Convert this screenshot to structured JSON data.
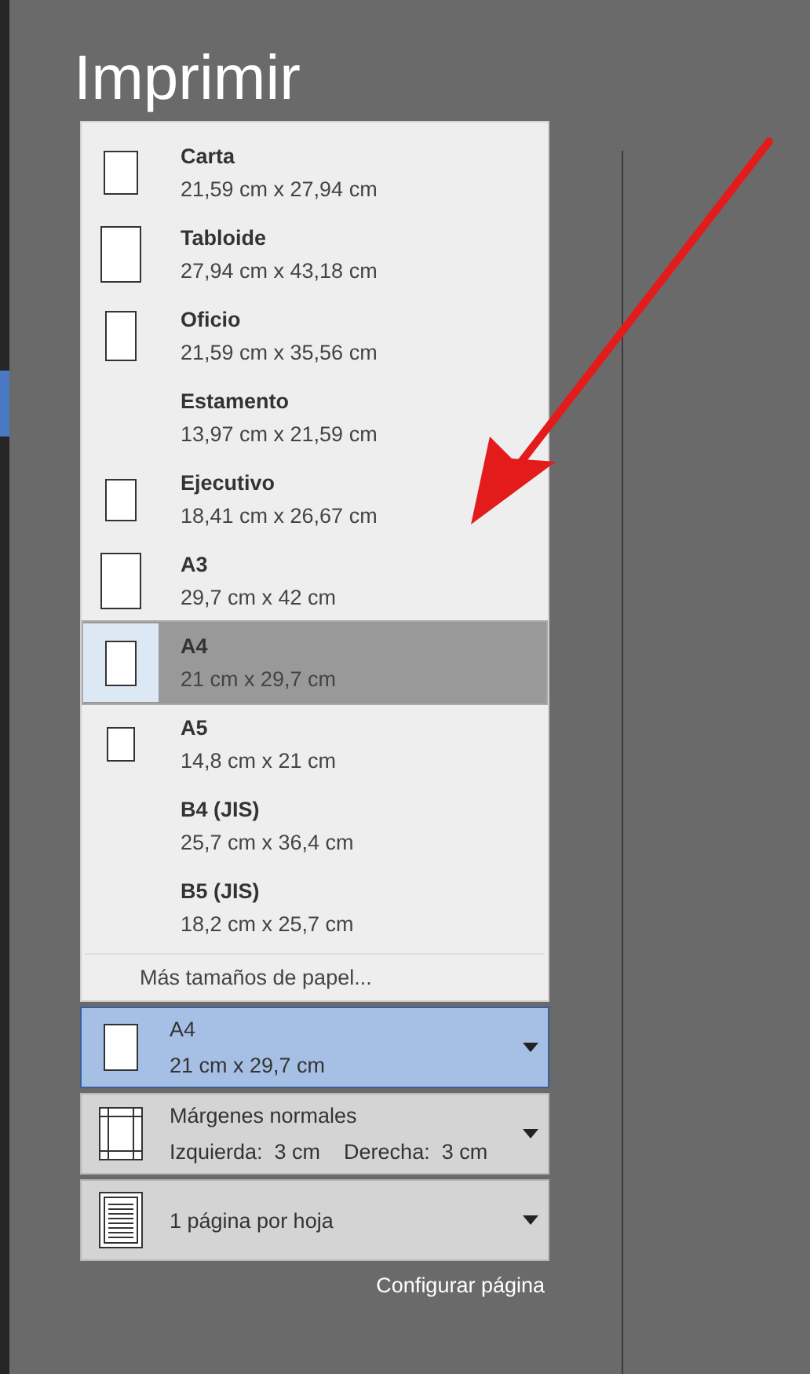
{
  "title": "Imprimir",
  "paper_sizes": [
    {
      "name": "Carta",
      "size": "21,59 cm x 27,94 cm",
      "kind": "letter",
      "selected": false
    },
    {
      "name": "Tabloide",
      "size": "27,94 cm x 43,18 cm",
      "kind": "tabloid",
      "selected": false
    },
    {
      "name": "Oficio",
      "size": "21,59 cm x 35,56 cm",
      "kind": "legal",
      "selected": false
    },
    {
      "name": "Estamento",
      "size": "13,97 cm x 21,59 cm",
      "selected": false
    },
    {
      "name": "Ejecutivo",
      "size": "18,41 cm x 26,67 cm",
      "kind": "executive",
      "selected": false
    },
    {
      "name": "A3",
      "size": "29,7 cm x 42 cm",
      "kind": "tabloid",
      "selected": false
    },
    {
      "name": "A4",
      "size": "21 cm x 29,7 cm",
      "kind": "a4",
      "selected": true
    },
    {
      "name": "A5",
      "size": "14,8 cm x 21 cm",
      "kind": "a5",
      "selected": false
    },
    {
      "name": "B4 (JIS)",
      "size": "25,7 cm x 36,4 cm",
      "selected": false
    },
    {
      "name": "B5 (JIS)",
      "size": "18,2 cm x 25,7 cm",
      "selected": false
    }
  ],
  "more_sizes": "Más tamaños de papel...",
  "settings": [
    {
      "kind": "paper",
      "open": true,
      "line_1": "A4",
      "line_2": "21 cm x 29,7 cm"
    },
    {
      "kind": "margins",
      "open": false,
      "line_1": "Márgenes normales",
      "line_2": "Izquierda:  3 cm    Derecha:  3 cm"
    },
    {
      "kind": "pages",
      "open": false,
      "line_1": "1 página por hoja"
    }
  ],
  "page_setup_link": "Configurar página"
}
